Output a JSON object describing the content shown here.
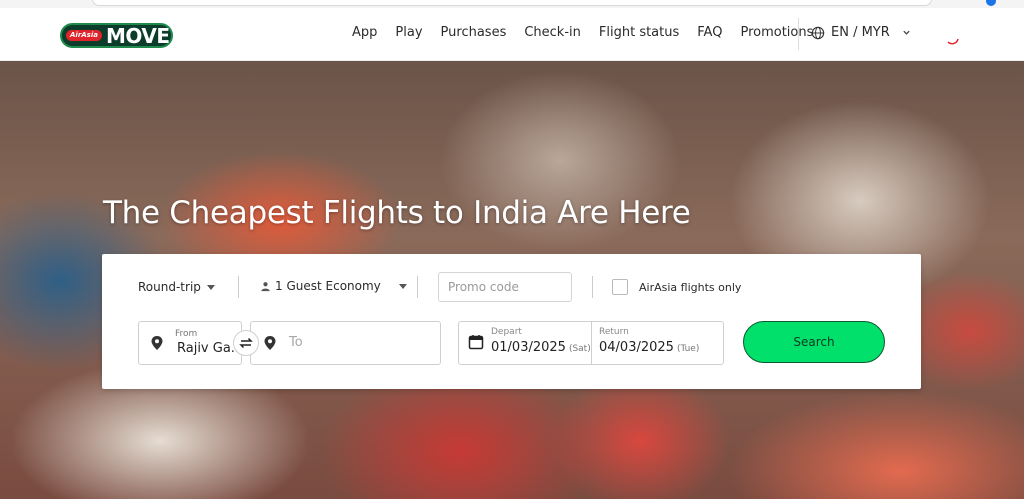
{
  "brand": {
    "logo_small": "AirAsia",
    "logo_main": "MOVE",
    "colors": {
      "accent_green": "#00e06a",
      "logo_bg": "#0b3d2a",
      "logo_red": "#e0242b"
    }
  },
  "nav": {
    "items": [
      {
        "label": "App"
      },
      {
        "label": "Play"
      },
      {
        "label": "Purchases"
      },
      {
        "label": "Check-in"
      },
      {
        "label": "Flight status"
      },
      {
        "label": "FAQ"
      },
      {
        "label": "Promotions"
      }
    ],
    "language": "EN / MYR"
  },
  "hero": {
    "title": "The Cheapest Flights to India Are Here"
  },
  "search": {
    "trip_type": "Round-trip",
    "guests": "1 Guest Economy",
    "promo_placeholder": "Promo code",
    "airasia_only_label": "AirAsia flights only",
    "from_label": "From",
    "from_value": "Rajiv Ga...",
    "to_placeholder": "To",
    "depart_label": "Depart",
    "depart_date": "01/03/2025",
    "depart_day": "(Sat)",
    "return_label": "Return",
    "return_date": "04/03/2025",
    "return_day": "(Tue)",
    "search_button": "Search"
  }
}
